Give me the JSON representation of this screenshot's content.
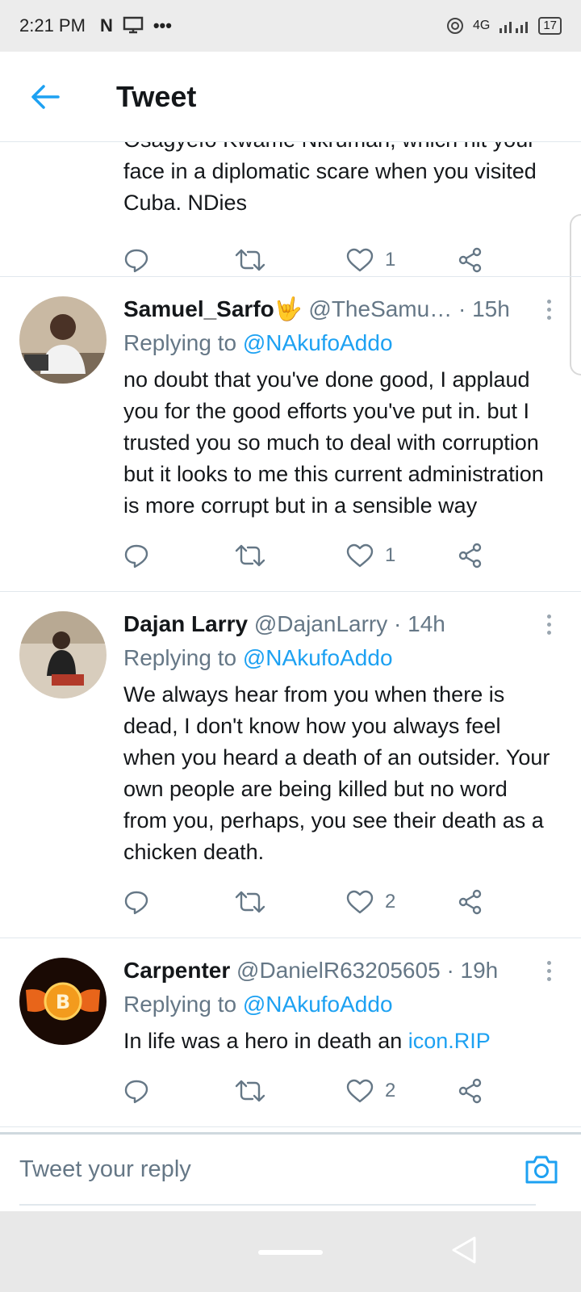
{
  "status_bar": {
    "time": "2:21 PM",
    "network": "4G",
    "battery": "17"
  },
  "header": {
    "title": "Tweet"
  },
  "partial_tweet": {
    "text": "Osagyefo Kwame Nkrumah, which hit your face in a diplomatic scare when you visited Cuba. NDies",
    "likes": "1"
  },
  "tweets": [
    {
      "name": "Samuel_Sarfo🤟",
      "handle": "@TheSamu…",
      "time": "· 15h",
      "replying_prefix": "Replying to ",
      "replying_to": "@NAkufoAddo",
      "text": "no doubt that you've done good, I applaud you for the good efforts you've put in. but I trusted you so much to deal with corruption but it looks to me this current administration is more corrupt but in a sensible way",
      "likes": "1"
    },
    {
      "name": "Dajan Larry",
      "handle": "@DajanLarry",
      "time": "· 14h",
      "replying_prefix": "Replying to ",
      "replying_to": "@NAkufoAddo",
      "text": "We always hear from you when there is dead, I don't know how you always feel when you heard a death of an outsider. Your own people are being killed but no word from you, perhaps, you see their death as a chicken death.",
      "likes": "2"
    },
    {
      "name": "Carpenter",
      "handle": "@DanielR63205605",
      "time": "· 19h",
      "replying_prefix": "Replying to ",
      "replying_to": "@NAkufoAddo",
      "text": "In life was a hero in death an ",
      "link": "icon.RIP",
      "likes": "2"
    }
  ],
  "reply_bar": {
    "placeholder": "Tweet your reply"
  },
  "colors": {
    "accent": "#1da1f2",
    "secondary_text": "#657786"
  }
}
